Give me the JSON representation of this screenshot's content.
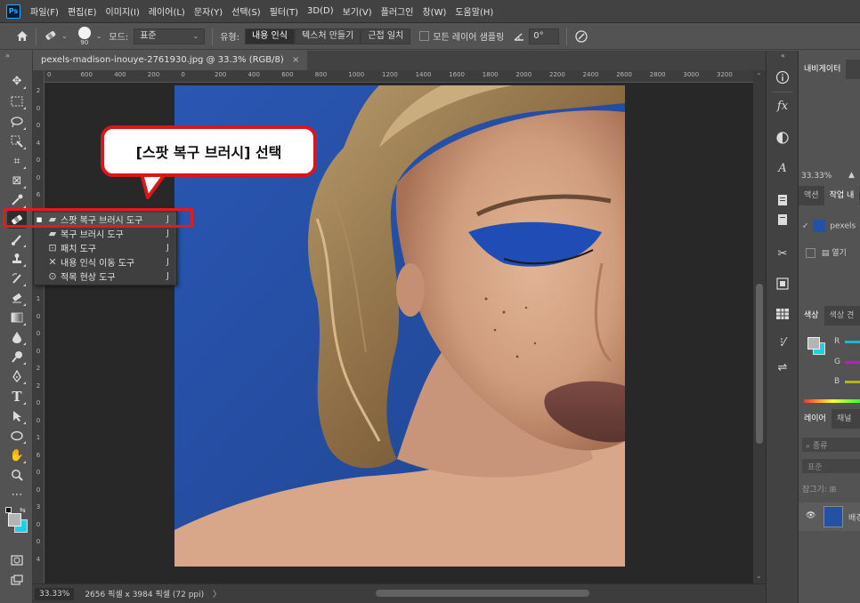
{
  "app": {
    "logo": "Ps",
    "menu": [
      "파일(F)",
      "편집(E)",
      "이미지(I)",
      "레이어(L)",
      "문자(Y)",
      "선택(S)",
      "필터(T)",
      "3D(D)",
      "보기(V)",
      "플러그인",
      "창(W)",
      "도움말(H)"
    ]
  },
  "options": {
    "brush_size": "90",
    "mode_label": "모드:",
    "mode_value": "표준",
    "type_label": "유형:",
    "type_buttons": [
      "내용 인식",
      "텍스처 만들기",
      "근접 일치"
    ],
    "sample_all_label": "모든 레이어 샘플링",
    "angle_value": "0°"
  },
  "document": {
    "tab_title": "pexels-madison-inouye-2761930.jpg @ 33.3% (RGB/8)",
    "tab_close": "×"
  },
  "ruler": {
    "top_labels": [
      "0",
      "600",
      "400",
      "200",
      "0",
      "200",
      "400",
      "600",
      "800",
      "1000",
      "1200",
      "1400",
      "1600",
      "1800",
      "2000",
      "2200",
      "2400",
      "2600",
      "2800",
      "3000",
      "3200"
    ],
    "left_labels": [
      "2",
      "0",
      "0",
      "4",
      "0",
      "0",
      "6",
      "0",
      "0",
      "8",
      "0",
      "0",
      "1",
      "0",
      "0",
      "0",
      "2",
      "2",
      "0",
      "0",
      "1",
      "6",
      "0",
      "0",
      "3",
      "0",
      "0",
      "4"
    ]
  },
  "status": {
    "zoom": "33.33%",
    "info": "2656 픽셀 x 3984 픽셀 (72 ppi)",
    "arrow": "〉"
  },
  "callout": {
    "text": "[스팟 복구 브러시] 선택"
  },
  "flyout": {
    "items": [
      {
        "label": "스팟 복구 브러시 도구",
        "key": "J",
        "icon": "spot-healing-icon",
        "active": true
      },
      {
        "label": "복구 브러시 도구",
        "key": "J",
        "icon": "healing-brush-icon",
        "active": false
      },
      {
        "label": "패치 도구",
        "key": "J",
        "icon": "patch-icon",
        "active": false
      },
      {
        "label": "내용 인식 이동 도구",
        "key": "J",
        "icon": "content-aware-move-icon",
        "active": false
      },
      {
        "label": "적목 현상 도구",
        "key": "J",
        "icon": "red-eye-icon",
        "active": false
      }
    ]
  },
  "panels": {
    "navigator_tab": "내비게이터",
    "zoom_value": "33.33%",
    "actions_tabs": [
      "액션",
      "작업 내"
    ],
    "history_item": "pexels",
    "history_open": "열기",
    "color_tabs": [
      "색상",
      "색상 견"
    ],
    "color_channels": [
      "R",
      "G",
      "B"
    ],
    "layer_tabs": [
      "레이어",
      "채널"
    ],
    "search_placeholder": "종류",
    "blend_mode": "표준",
    "lock_label": "잠그기:",
    "layer_name": "배경"
  },
  "colors": {
    "accent_red": "#d9171b",
    "foreground_swatch": "#b4b4b4",
    "background_swatch": "#1ad1e6",
    "photo_bg_blue": "#2450a6"
  }
}
